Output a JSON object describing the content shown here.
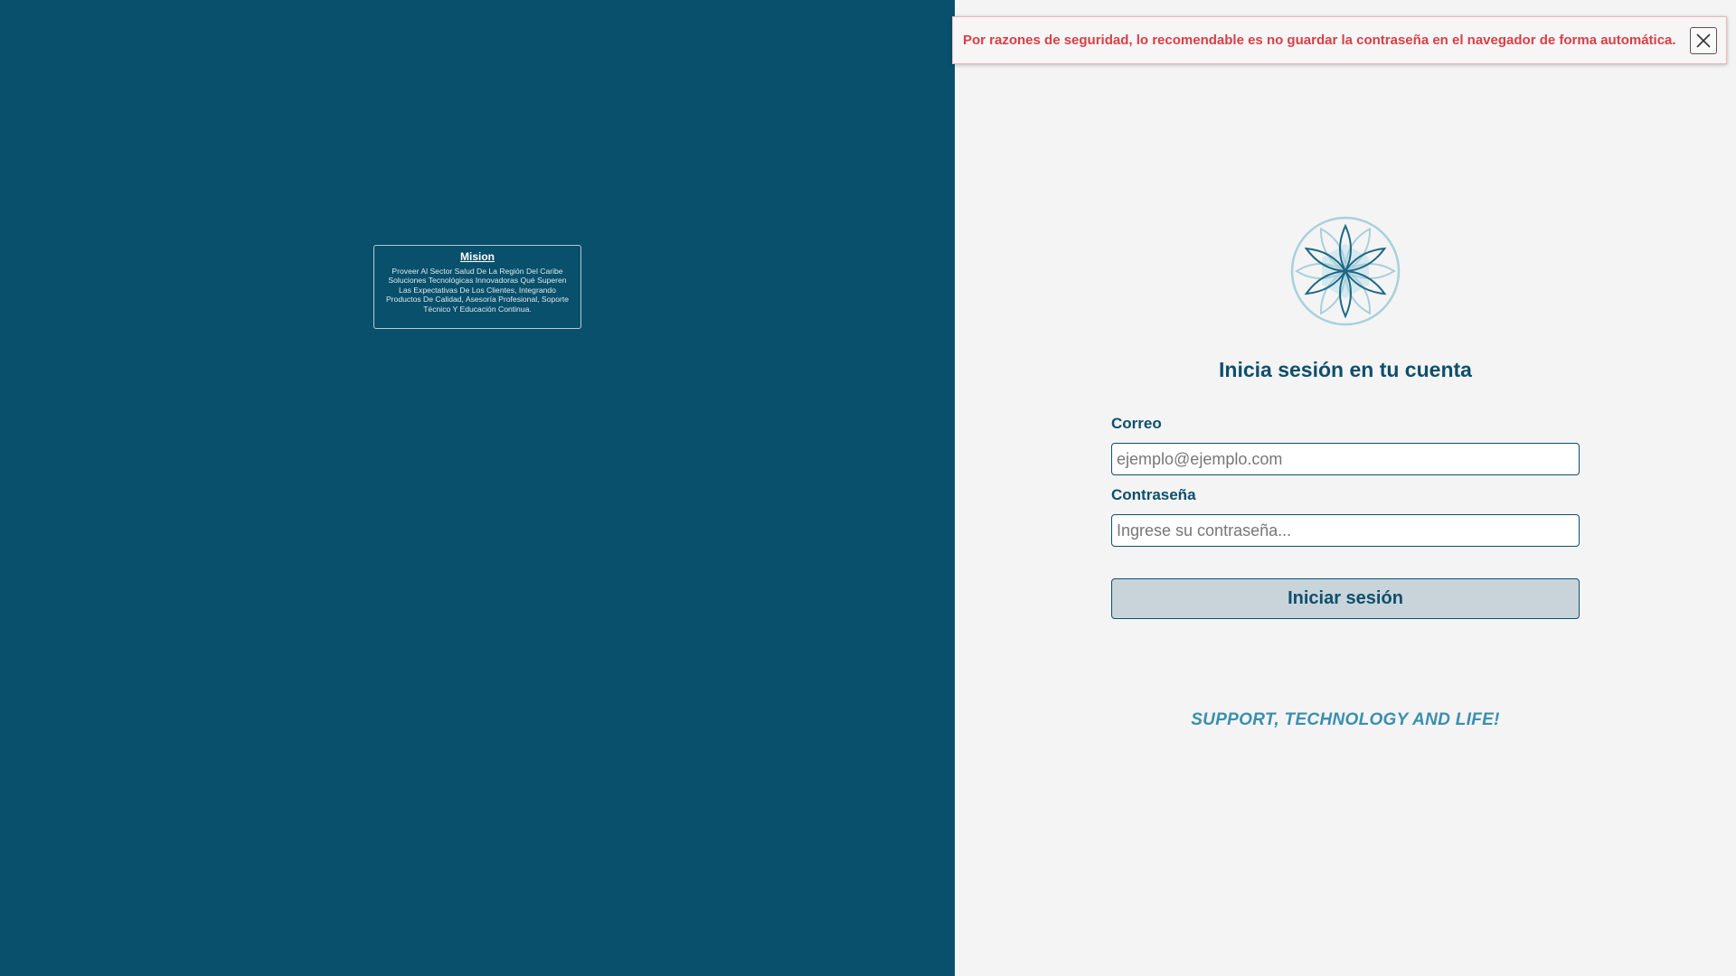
{
  "mission": {
    "title": "Mision",
    "text": "Proveer Al Sector Salud De La Región Del Caribe Soluciones Tecnológicas Innovadoras Qué Superen Las Expectativas De Los Clientes, Integrando Productos De Calidad, Asesoría Profesional, Soporte Técnico Y Educación Continua."
  },
  "alert": {
    "message": "Por razones de seguridad, lo recomendable es no guardar la contraseña en el navegador de forma automática.",
    "close_icon": "close-icon"
  },
  "logo": {
    "icon": "flower-of-life-logo",
    "colors": {
      "ring": "#a9d0dc",
      "petal": "#1d6884",
      "fill": "#cde6ee"
    }
  },
  "login": {
    "title": "Inicia sesión en tu cuenta",
    "email_label": "Correo",
    "email_placeholder": "ejemplo@ejemplo.com",
    "password_label": "Contraseña",
    "password_placeholder": "Ingrese su contraseña...",
    "submit_label": "Iniciar sesión"
  },
  "slogan": "SUPPORT, TECHNOLOGY AND LIFE!",
  "colors": {
    "left_panel": "#08506c",
    "right_panel": "#f4f4f4",
    "primary": "#0d4f6c",
    "alert_text": "#d64047",
    "slogan": "#3a8fae"
  }
}
